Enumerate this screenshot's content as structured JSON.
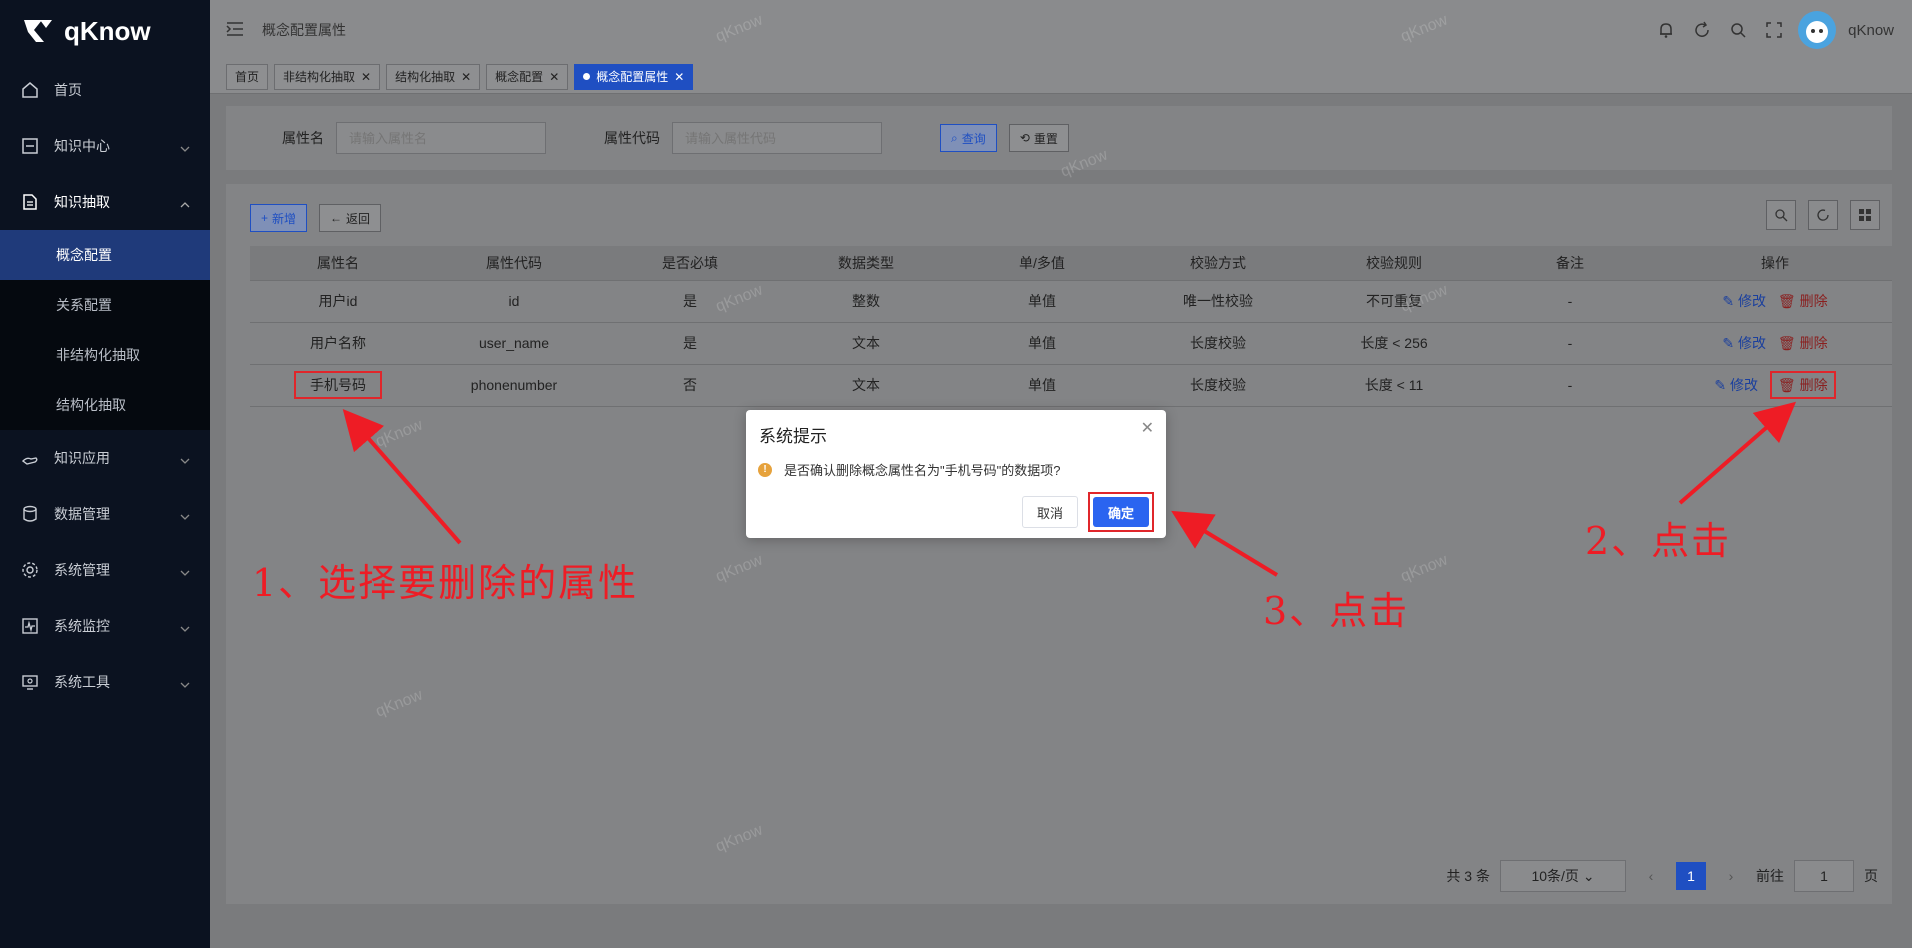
{
  "app": {
    "name": "qKnow"
  },
  "sidebar": {
    "items": [
      {
        "label": "首页",
        "icon": "home-icon",
        "has_children": false
      },
      {
        "label": "知识中心",
        "icon": "book-icon",
        "has_children": true
      },
      {
        "label": "知识抽取",
        "icon": "document-icon",
        "has_children": true,
        "expanded": true,
        "children": [
          "概念配置",
          "关系配置",
          "非结构化抽取",
          "结构化抽取"
        ],
        "active_child": "概念配置"
      },
      {
        "label": "知识应用",
        "icon": "hand-icon",
        "has_children": true
      },
      {
        "label": "数据管理",
        "icon": "database-icon",
        "has_children": true
      },
      {
        "label": "系统管理",
        "icon": "gear-icon",
        "has_children": true
      },
      {
        "label": "系统监控",
        "icon": "monitor-icon",
        "has_children": true
      },
      {
        "label": "系统工具",
        "icon": "tool-icon",
        "has_children": true
      }
    ]
  },
  "navbar": {
    "page_title": "概念配置属性",
    "user_name": "qKnow"
  },
  "tags": [
    {
      "label": "首页",
      "closable": false
    },
    {
      "label": "非结构化抽取",
      "closable": true
    },
    {
      "label": "结构化抽取",
      "closable": true
    },
    {
      "label": "概念配置",
      "closable": true
    },
    {
      "label": "概念配置属性",
      "closable": true,
      "active": true
    }
  ],
  "search": {
    "field1_label": "属性名",
    "field1_placeholder": "请输入属性名",
    "field2_label": "属性代码",
    "field2_placeholder": "请输入属性代码",
    "query_label": "查询",
    "reset_label": "重置"
  },
  "toolbar": {
    "add_label": "新增",
    "back_label": "返回"
  },
  "table": {
    "headers": [
      "属性名",
      "属性代码",
      "是否必填",
      "数据类型",
      "单/多值",
      "校验方式",
      "校验规则",
      "备注",
      "操作"
    ],
    "rows": [
      [
        "用户id",
        "id",
        "是",
        "整数",
        "单值",
        "唯一性校验",
        "不可重复",
        "-"
      ],
      [
        "用户名称",
        "user_name",
        "是",
        "文本",
        "单值",
        "长度校验",
        "长度 < 256",
        "-"
      ],
      [
        "手机号码",
        "phonenumber",
        "否",
        "文本",
        "单值",
        "长度校验",
        "长度 < 11",
        "-"
      ]
    ],
    "edit_label": "修改",
    "delete_label": "删除"
  },
  "pager": {
    "total": "共 3 条",
    "page_size": "10条/页",
    "current": "1",
    "goto_label": "前往",
    "goto_value": "1",
    "page_unit": "页"
  },
  "dialog": {
    "title": "系统提示",
    "message": "是否确认删除概念属性名为\"手机号码\"的数据项?",
    "cancel_label": "取消",
    "ok_label": "确定"
  },
  "annotations": {
    "step1": "1、选择要删除的属性",
    "step2": "2、点击",
    "step3": "3、点击"
  },
  "watermark": "qKnow",
  "colors": {
    "accent": "#1f4fc2",
    "annotation": "#ee1c25",
    "sidebar_bg": "#0b1220"
  }
}
